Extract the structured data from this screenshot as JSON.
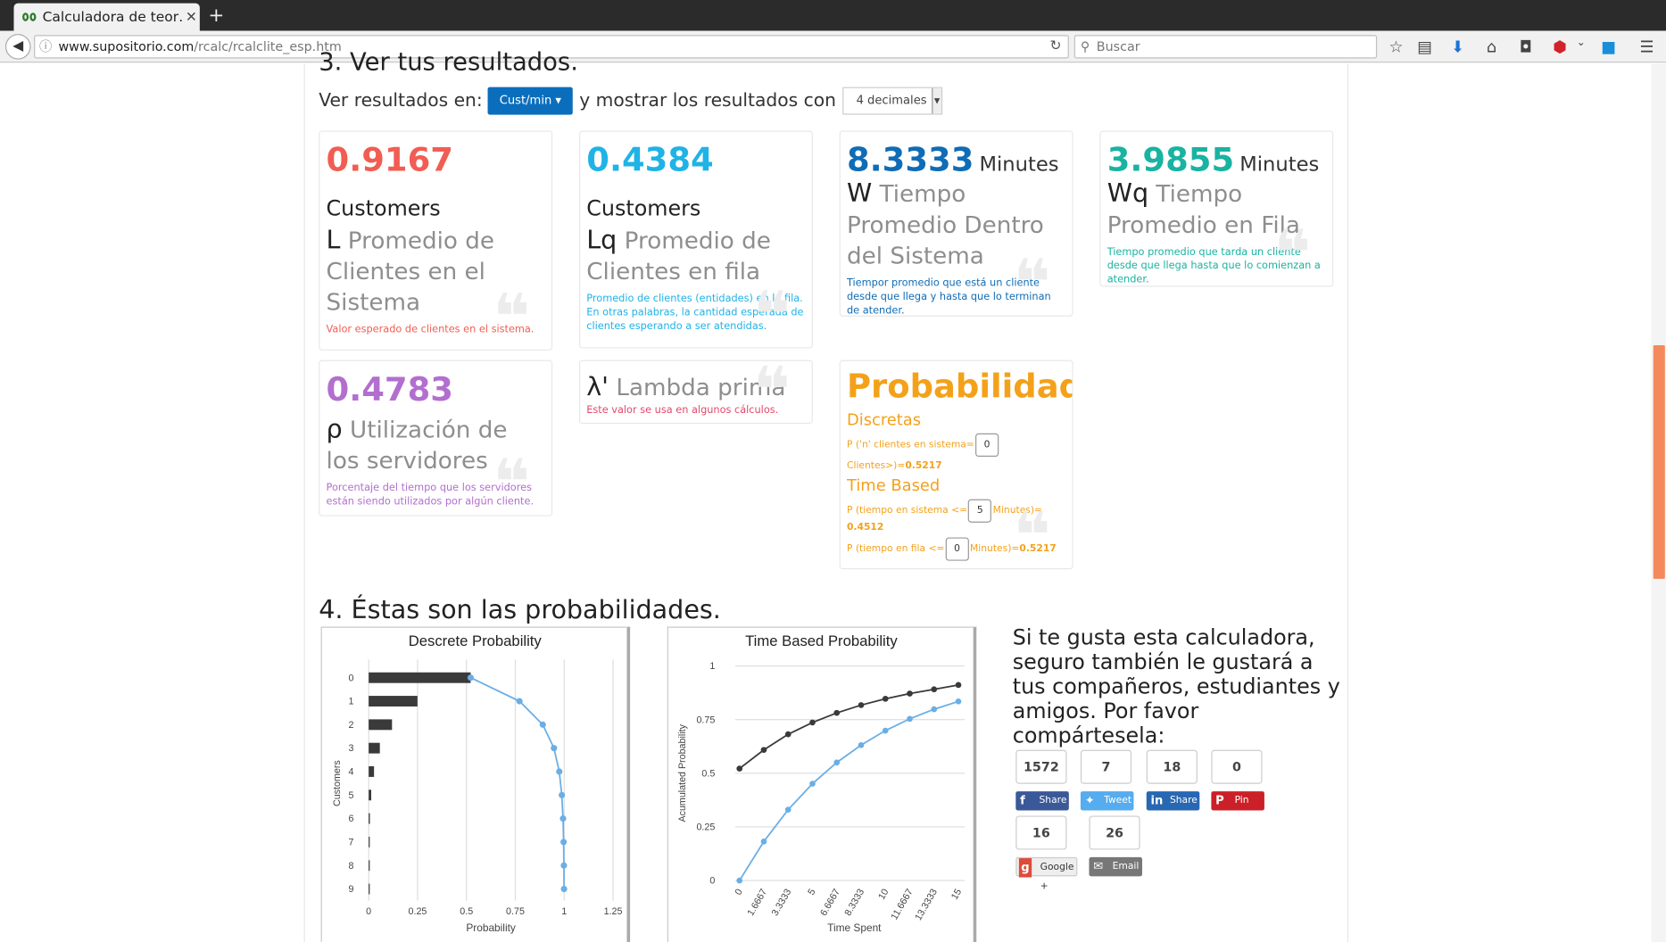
{
  "browser": {
    "tab_title": "Calculadora de teor…",
    "tab_close": "✕",
    "new_tab": "+",
    "url_host": "www.supositorio.com",
    "url_path": "/rcalc/rcalclite_esp.htm",
    "search_placeholder": "Buscar"
  },
  "section3": {
    "heading": "3. Ver tus resultados.",
    "view_label": "Ver resultados en:",
    "unit_button": "Cust/min ▾",
    "show_label": "y mostrar los resultados con",
    "decimals": "4 decimales"
  },
  "cards": {
    "L": {
      "value": "0.9167",
      "unit": "Customers",
      "sym": "L",
      "name": "Promedio de Clientes en el Sistema",
      "desc": "Valor esperado de clientes en el sistema.",
      "color": "#f15d52"
    },
    "Lq": {
      "value": "0.4384",
      "unit": "Customers",
      "sym": "Lq",
      "name": "Promedio de Clientes en fila",
      "desc": "Promedio de clientes (entidades) en la fila. En otras palabras, la cantidad esperada de clientes esperando a ser atendidas.",
      "color": "#1fb3e6"
    },
    "W": {
      "value": "8.3333",
      "unit": "Minutes",
      "sym": "W",
      "name": "Tiempo Promedio Dentro del Sistema",
      "desc": "Tiempor promedio que está un cliente desde que llega y hasta que lo terminan de atender.",
      "color": "#0f6cb6"
    },
    "Wq": {
      "value": "3.9855",
      "unit": "Minutes",
      "sym": "Wq",
      "name": "Tiempo Promedio en Fila",
      "desc": "Tiempo promedio que tarda un cliente desde que llega hasta que lo comienzan a atender.",
      "color": "#19b3a1"
    },
    "rho": {
      "value": "0.4783",
      "sym": "ρ",
      "name": "Utilización de los servidores",
      "desc": "Porcentaje del tiempo que los servidores están siendo utilizados por algún cliente.",
      "color": "#b26fcf"
    },
    "lambda": {
      "sym": "λ'",
      "name": "Lambda prima",
      "desc": "Este valor se usa en algunos cálculos.",
      "color": "#e04b6a"
    }
  },
  "prob": {
    "title": "Probabilidades",
    "discrete_label": "Discretas",
    "discrete_prefix": "P ('n' clientes en sistema=",
    "discrete_input": "0",
    "discrete_suffix": "Clientes>)=",
    "discrete_value": "0.5217",
    "time_label": "Time Based",
    "sys_prefix": "P (tiempo en sistema <=",
    "sys_input": "5",
    "sys_suffix": "Minutes)=",
    "sys_value": "0.4512",
    "queue_prefix": "P (tiempo en fila <=",
    "queue_input": "0",
    "queue_suffix": "Minutes)=",
    "queue_value": "0.5217",
    "color": "#f4a11a"
  },
  "section4": {
    "heading": "4. Éstas son las probabilidades."
  },
  "chart_data": [
    {
      "type": "bar",
      "title": "Descrete Probability",
      "xlabel": "Probability",
      "ylabel": "Customers",
      "orientation": "horizontal",
      "categories": [
        "0",
        "1",
        "2",
        "3",
        "4",
        "5",
        "6",
        "7",
        "8",
        "9"
      ],
      "xlim": [
        0,
        1.25
      ],
      "xticks": [
        "0",
        "0.25",
        "0.5",
        "0.75",
        "1",
        "1.25"
      ],
      "series": [
        {
          "values": [
            0.5217,
            0.2495,
            0.1193,
            0.0571,
            0.0273,
            0.013,
            0.0062,
            0.003,
            0.0014,
            0.0007
          ]
        },
        {
          "type": "line",
          "values": [
            0.5217,
            0.7712,
            0.8905,
            0.9476,
            0.9749,
            0.9879,
            0.9941,
            0.9971,
            0.9985,
            0.9992
          ]
        }
      ]
    },
    {
      "type": "line",
      "title": "Time Based Probability",
      "xlabel": "Time Spent",
      "ylabel": "Acumulated Probability",
      "x": [
        "0",
        "1.6667",
        "3.3333",
        "5",
        "6.6667",
        "8.3333",
        "10",
        "11.6667",
        "13.3333",
        "15"
      ],
      "ylim": [
        0,
        1
      ],
      "yticks": [
        "0",
        "0.25",
        "0.5",
        "0.75",
        "1"
      ],
      "series": [
        {
          "values": [
            0.5217,
            0.6088,
            0.6817,
            0.7366,
            0.7813,
            0.8176,
            0.8471,
            0.8714,
            0.8913,
            0.9115
          ],
          "color": "#3a3a3a"
        },
        {
          "values": [
            0.0,
            0.1817,
            0.3301,
            0.4512,
            0.5502,
            0.6311,
            0.6987,
            0.7535,
            0.7982,
            0.8347
          ],
          "color": "#6aaee6"
        }
      ]
    }
  ],
  "share": {
    "text": "Si te gusta esta calculadora, seguro también le gustará a tus compañeros, estudiantes y amigos. Por favor compártesela:",
    "counts": {
      "facebook": "1572",
      "twitter": "7",
      "linkedin": "18",
      "pinterest": "0",
      "google": "16",
      "email": "26"
    },
    "buttons": {
      "facebook": "Share",
      "twitter": "Tweet",
      "linkedin": "Share",
      "pinterest": "Pin",
      "google": "Google +",
      "email": "Email"
    }
  }
}
